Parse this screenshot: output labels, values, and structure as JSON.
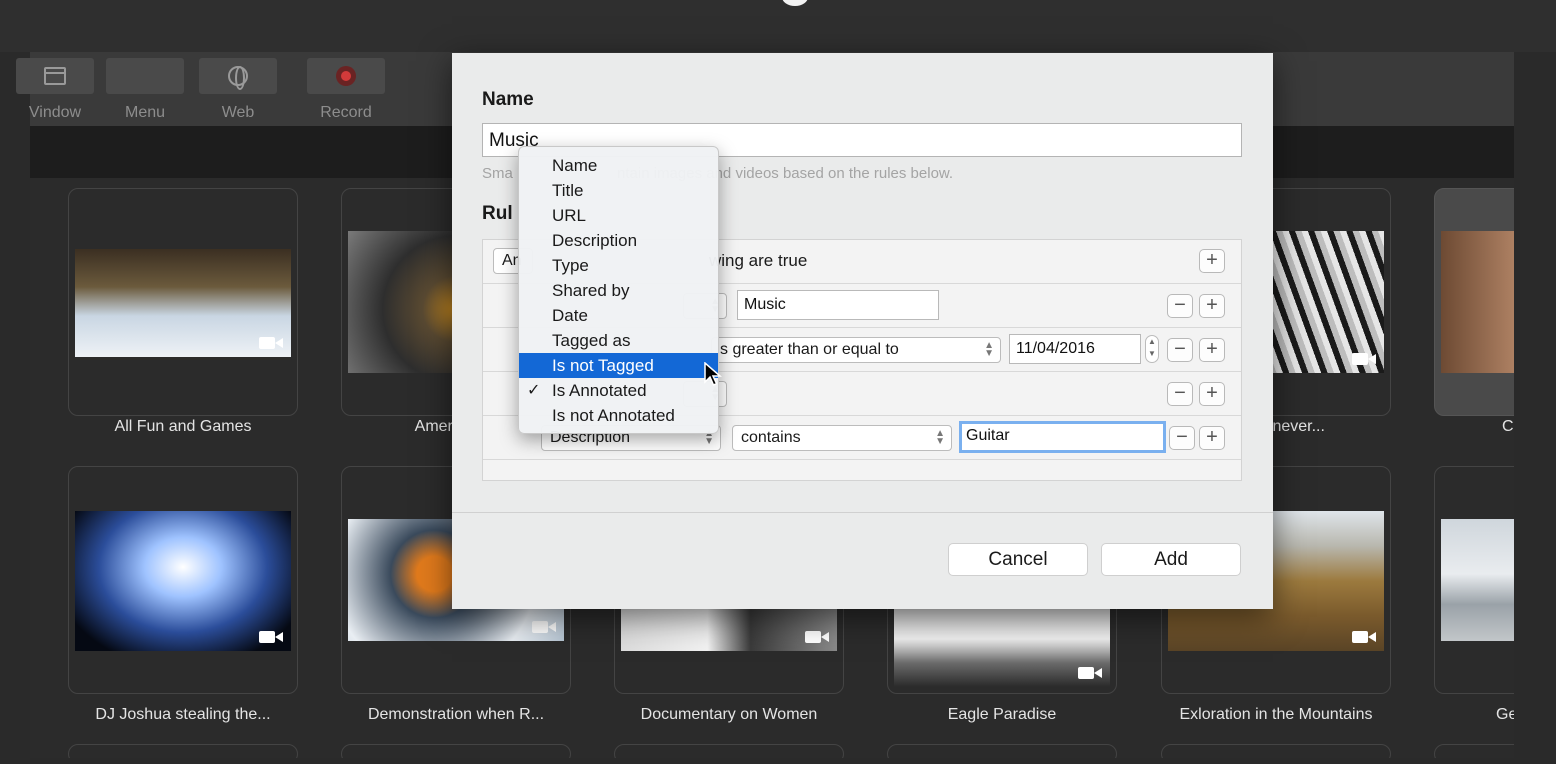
{
  "toolbar": {
    "items": [
      {
        "label": "Vindow",
        "icon": "window-icon"
      },
      {
        "label": "Menu",
        "icon": "menu-icon"
      },
      {
        "label": "Web",
        "icon": "globe-icon"
      },
      {
        "label": "Record",
        "icon": "record-icon"
      }
    ]
  },
  "grid": {
    "row1": [
      {
        "caption": "All Fun and Games"
      },
      {
        "caption": "American S"
      },
      {
        "caption": ""
      },
      {
        "caption": ""
      },
      {
        "caption": "Audio never..."
      },
      {
        "caption": "C"
      }
    ],
    "row2": [
      {
        "caption": "DJ Joshua stealing the..."
      },
      {
        "caption": "Demonstration when R..."
      },
      {
        "caption": "Documentary on Women"
      },
      {
        "caption": "Eagle Paradise"
      },
      {
        "caption": "Exloration in the Mountains"
      },
      {
        "caption": "Ge"
      }
    ]
  },
  "dialog": {
    "name_label": "Name",
    "name_value": "Music",
    "hint": "Sma                         ntain images and videos based on the rules below.",
    "rules_label": "Rul",
    "match_prefix": "An",
    "match_suffix": "wing are true",
    "rule1_value": "Music",
    "rule2_operator": "s greater than or equal to",
    "rule2_date": "11/04/2016",
    "rule4_field": "Description",
    "rule4_operator": "contains",
    "rule4_value": "Guitar",
    "cancel": "Cancel",
    "add": "Add"
  },
  "menu": {
    "items": [
      {
        "label": "Name"
      },
      {
        "label": "Title"
      },
      {
        "label": "URL"
      },
      {
        "label": "Description"
      },
      {
        "label": "Type"
      },
      {
        "label": "Shared by"
      },
      {
        "label": "Date"
      },
      {
        "label": "Tagged as"
      },
      {
        "label": "Is not Tagged",
        "highlighted": true
      },
      {
        "label": "Is Annotated",
        "checked": true
      },
      {
        "label": "Is not Annotated"
      }
    ],
    "check_glyph": "✓"
  },
  "colors": {
    "accent": "#1368d6",
    "focus_ring": "#7ab0ef",
    "background": "#2a2a2a"
  }
}
